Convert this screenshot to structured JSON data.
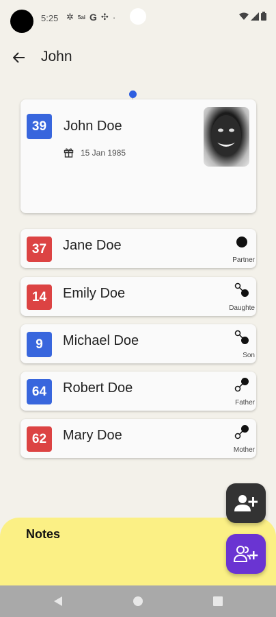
{
  "status": {
    "time": "5:25",
    "small_text": "5ai",
    "g_text": "G"
  },
  "header": {
    "title": "John"
  },
  "main_person": {
    "age": "39",
    "name": "John Doe",
    "birth_date": "15 Jan 1985",
    "badge_color": "#3866dd"
  },
  "relatives": [
    {
      "age": "37",
      "name": "Jane Doe",
      "relation": "Partner",
      "badge_color": "#dc4343",
      "icon": "partner-dot-icon"
    },
    {
      "age": "14",
      "name": "Emily Doe",
      "relation": "Daughte",
      "badge_color": "#dc4343",
      "icon": "child-link-icon"
    },
    {
      "age": "9",
      "name": "Michael Doe",
      "relation": "Son",
      "badge_color": "#3866dd",
      "icon": "child-link-icon"
    },
    {
      "age": "64",
      "name": "Robert Doe",
      "relation": "Father",
      "badge_color": "#3866dd",
      "icon": "parent-link-icon"
    },
    {
      "age": "62",
      "name": "Mary Doe",
      "relation": "Mother",
      "badge_color": "#dc4343",
      "icon": "parent-link-icon"
    }
  ],
  "notes": {
    "title": "Notes"
  },
  "colors": {
    "background": "#f3f1ea",
    "notes": "#fbf085",
    "fab_dark": "#333333",
    "fab_purple": "#6a34d2"
  }
}
